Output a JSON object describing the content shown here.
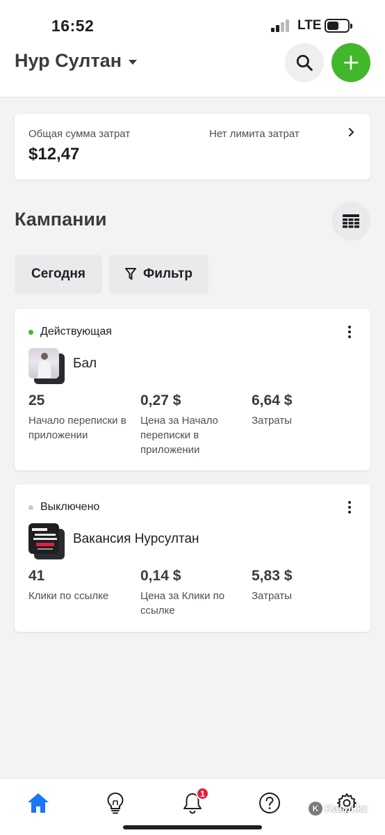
{
  "status_bar": {
    "time": "16:52",
    "network": "LTE",
    "battery_level": 0.5
  },
  "header": {
    "account_name": "Нур Султан",
    "icons": {
      "search": "search-icon",
      "add": "plus-icon",
      "dropdown": "caret-down-icon"
    },
    "colors": {
      "add_button": "#42b72a"
    }
  },
  "spend": {
    "label": "Общая сумма затрат",
    "value": "$12,47",
    "limit_label": "Нет лимита затрат"
  },
  "campaigns_section": {
    "title": "Кампании",
    "date_filter": "Сегодня",
    "filter_label": "Фильтр"
  },
  "campaigns": [
    {
      "status": "Действующая",
      "status_color": "#42b72a",
      "name": "Бал",
      "metrics": [
        {
          "value": "25",
          "label": "Начало переписки в приложении"
        },
        {
          "value": "0,27 $",
          "label": "Цена за Начало переписки в приложении"
        },
        {
          "value": "6,64 $",
          "label": "Затраты"
        }
      ]
    },
    {
      "status": "Выключено",
      "status_color": "#c9cbcf",
      "name": "Вакансия Нурсултан",
      "metrics": [
        {
          "value": "41",
          "label": "Клики по ссылке"
        },
        {
          "value": "0,14 $",
          "label": "Цена за Клики по ссылке"
        },
        {
          "value": "5,83 $",
          "label": "Затраты"
        }
      ]
    }
  ],
  "tabbar": {
    "items": [
      {
        "name": "home-icon",
        "active": true
      },
      {
        "name": "lightbulb-icon",
        "active": false
      },
      {
        "name": "bell-icon",
        "active": false,
        "badge": "1"
      },
      {
        "name": "help-icon",
        "active": false
      },
      {
        "name": "settings-icon",
        "active": false
      }
    ],
    "active_color": "#1877f2"
  },
  "watermark": {
    "text": "Kaspi.kz",
    "icon_letter": "K"
  }
}
